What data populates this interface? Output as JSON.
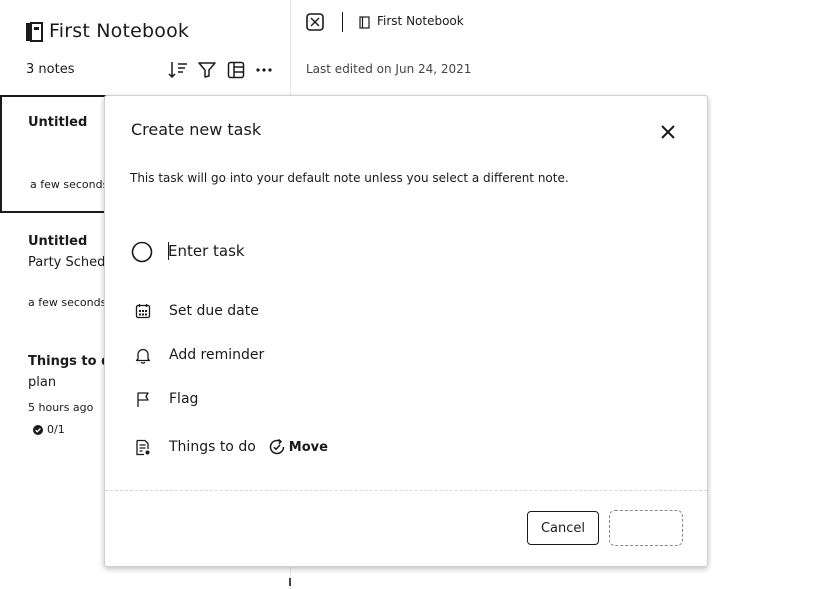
{
  "notebook": {
    "title": "First Notebook",
    "note_count": "3 notes",
    "toolbar": [
      "sort-icon",
      "filter-icon",
      "view-icon",
      "more-icon"
    ],
    "more_label": "···"
  },
  "notes": [
    {
      "title": "Untitled",
      "preview": "",
      "time": "a few seconds",
      "selected": true
    },
    {
      "title": "Untitled",
      "preview": "Party Schedu",
      "time": "a few seconds"
    },
    {
      "title": "Things to do",
      "preview": "plan",
      "time": "5 hours ago",
      "progress": "0/1"
    }
  ],
  "header": {
    "breadcrumb": "First Notebook",
    "last_edited": "Last edited on Jun 24, 2021"
  },
  "dialog": {
    "title": "Create new task",
    "description": "This task will go into your default note unless you select a different note.",
    "task_placeholder": "Enter task",
    "options": {
      "due_date": "Set due date",
      "reminder": "Add reminder",
      "flag": "Flag",
      "note": "Things to do",
      "move": "Move"
    },
    "cancel_label": "Cancel",
    "save_label": ""
  },
  "colors": {
    "text": "#1a1a1a",
    "border": "#cfcfcf",
    "background": "#ffffff"
  }
}
